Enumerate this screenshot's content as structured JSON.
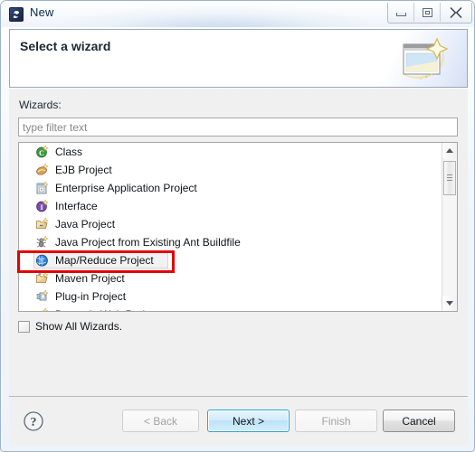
{
  "window": {
    "title": "New",
    "icon": "eclipse-new-icon",
    "controls": {
      "minimize": "minimize-button",
      "maximize": "maximize-button",
      "close": "close-button"
    }
  },
  "header": {
    "title": "Select a wizard",
    "banner_icon": "wizard-sparkle-icon"
  },
  "body": {
    "wizards_label": "Wizards:",
    "filter": {
      "value": "",
      "placeholder": "type filter text"
    },
    "list": {
      "items": [
        {
          "label": "Class",
          "icon": "java-class-icon",
          "selected": false
        },
        {
          "label": "EJB Project",
          "icon": "ejb-project-icon",
          "selected": false
        },
        {
          "label": "Enterprise Application Project",
          "icon": "enterprise-application-icon",
          "selected": false
        },
        {
          "label": "Interface",
          "icon": "java-interface-icon",
          "selected": false
        },
        {
          "label": "Java Project",
          "icon": "java-project-icon",
          "selected": false
        },
        {
          "label": "Java Project from Existing Ant Buildfile",
          "icon": "ant-buildfile-icon",
          "selected": false
        },
        {
          "label": "Map/Reduce Project",
          "icon": "map-reduce-project-icon",
          "selected": true
        },
        {
          "label": "Maven Project",
          "icon": "maven-project-icon",
          "selected": false
        },
        {
          "label": "Plug-in Project",
          "icon": "plugin-project-icon",
          "selected": false
        },
        {
          "label": "Dynamic Web Project",
          "icon": "dynamic-web-project-icon",
          "selected": false
        }
      ],
      "scrollbar": {
        "up_arrow": "scroll-up-arrow",
        "down_arrow": "scroll-down-arrow",
        "thumb": "scroll-thumb"
      }
    },
    "show_all_wizards": {
      "label": "Show All Wizards.",
      "checked": false
    }
  },
  "annotation": {
    "target": "Map/Reduce Project",
    "color": "#e40000"
  },
  "footer": {
    "help": "help-button",
    "buttons": [
      {
        "label": "< Back",
        "state": "disabled"
      },
      {
        "label": "Next >",
        "state": "default"
      },
      {
        "label": "Finish",
        "state": "disabled"
      },
      {
        "label": "Cancel",
        "state": "normal"
      }
    ]
  },
  "colors": {
    "accent": "#2aa5e0",
    "annotation": "#e40000",
    "dialog_background": "#f0f0f0",
    "panel_background": "#ffffff"
  }
}
